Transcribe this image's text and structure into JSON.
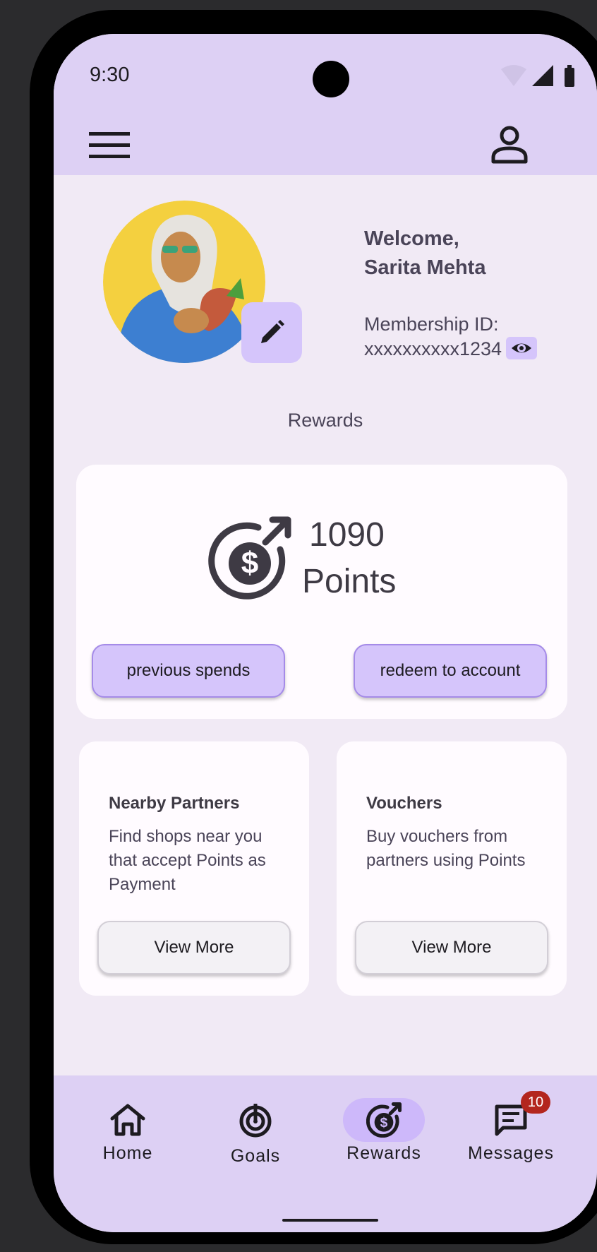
{
  "status_bar": {
    "time": "9:30"
  },
  "profile": {
    "welcome_line1": "Welcome,",
    "welcome_name": "Sarita Mehta",
    "membership_label": "Membership ID:",
    "membership_id": "xxxxxxxxxx1234"
  },
  "section_title": "Rewards",
  "points": {
    "value": "1090",
    "label": "Points",
    "previous_spends_label": "previous spends",
    "redeem_label": "redeem to account"
  },
  "cards": [
    {
      "title": "Nearby Partners",
      "description": "Find shops near you that accept Points as Payment",
      "button": "View More"
    },
    {
      "title": "Vouchers",
      "description": "Buy vouchers from partners using Points",
      "button": "View More"
    }
  ],
  "nav": {
    "items": [
      {
        "label": "Home",
        "icon": "home-icon"
      },
      {
        "label": "Goals",
        "icon": "target-icon"
      },
      {
        "label": "Rewards",
        "icon": "rewards-icon",
        "active": true
      },
      {
        "label": "Messages",
        "icon": "message-icon",
        "badge": "10"
      }
    ]
  },
  "colors": {
    "accent": "#d5c5fb",
    "appbar": "#ddd0f4",
    "background": "#f1eaf5",
    "badge": "#b3261e"
  }
}
